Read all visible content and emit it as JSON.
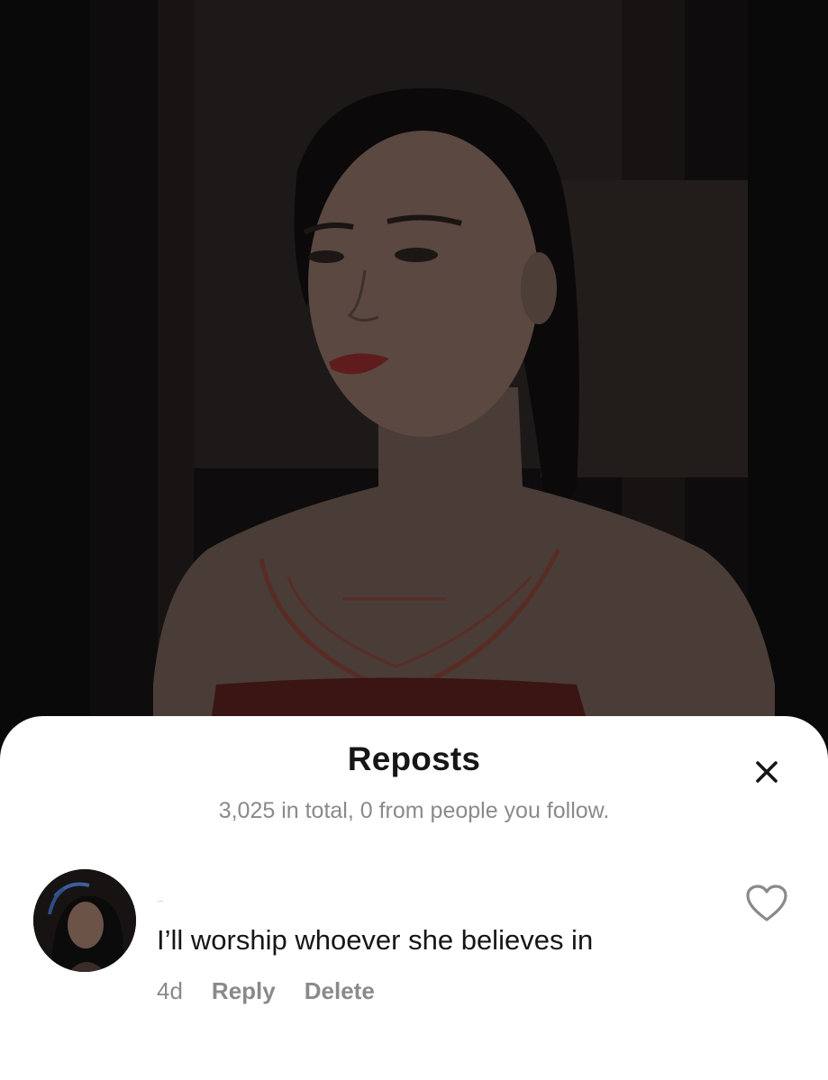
{
  "video": {
    "icon": "video-still-image"
  },
  "sheet": {
    "title": "Reposts",
    "subtitle": "3,025 in total, 0 from people you follow.",
    "close_icon": "close-icon"
  },
  "comment": {
    "avatar_icon": "user-avatar",
    "text": "I’ll worship whoever she believes in",
    "age": "4d",
    "reply_label": "Reply",
    "delete_label": "Delete",
    "like_icon": "heart-outline-icon"
  },
  "colors": {
    "sheet_background": "#ffffff",
    "title_text": "#161616",
    "secondary_text": "#8a8a8a",
    "video_background": "#0b0a0a"
  }
}
